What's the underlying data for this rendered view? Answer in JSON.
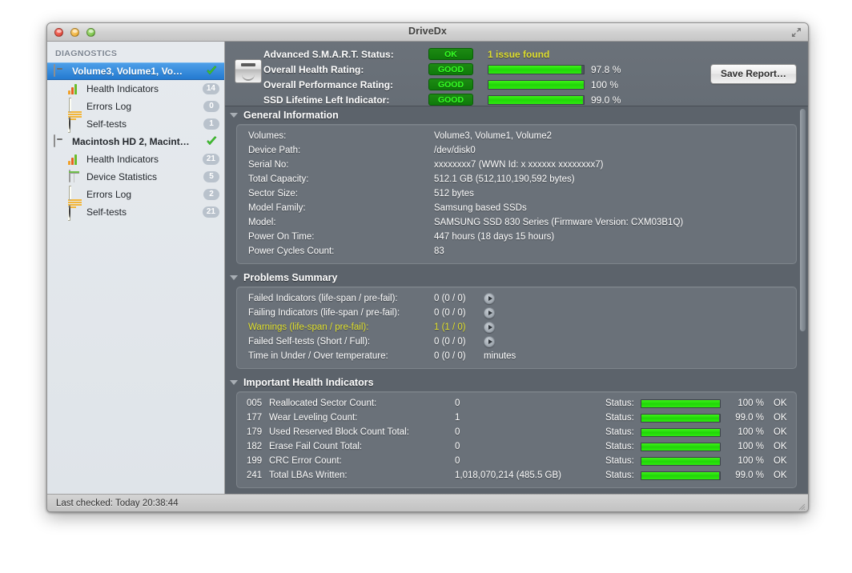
{
  "window": {
    "title": "DriveDx",
    "traffic_lights": [
      "close",
      "minimize",
      "zoom"
    ],
    "fullscreen_icon": "fullscreen-icon"
  },
  "sidebar": {
    "header": "DIAGNOSTICS",
    "items": [
      {
        "label": "Volume3, Volume1, Vo…",
        "icon": "disk-icon",
        "type": "disk",
        "selected": true,
        "status": "ok-check"
      },
      {
        "label": "Health Indicators",
        "icon": "bar-chart-icon",
        "type": "child",
        "badge": "14"
      },
      {
        "label": "Errors Log",
        "icon": "log-icon",
        "type": "child",
        "badge": "0"
      },
      {
        "label": "Self-tests",
        "icon": "pie-icon",
        "type": "child",
        "badge": "1"
      },
      {
        "label": "Macintosh HD 2, Macint…",
        "icon": "disk-icon",
        "type": "disk",
        "selected": false,
        "status": "ok-check"
      },
      {
        "label": "Health Indicators",
        "icon": "bar-chart-icon",
        "type": "child",
        "badge": "21"
      },
      {
        "label": "Device Statistics",
        "icon": "table-icon",
        "type": "child",
        "badge": "5"
      },
      {
        "label": "Errors Log",
        "icon": "log-icon",
        "type": "child",
        "badge": "2"
      },
      {
        "label": "Self-tests",
        "icon": "pie-icon",
        "type": "child",
        "badge": "21"
      }
    ]
  },
  "summary": {
    "disk_icon": "hard-disk-icon",
    "save_report_label": "Save Report…",
    "rows": [
      {
        "label": "Advanced S.M.A.R.T. Status:",
        "badge": "OK",
        "issue": "1 issue found"
      },
      {
        "label": "Overall Health Rating:",
        "badge": "GOOD",
        "percent": "97.8 %",
        "fill": 97.8
      },
      {
        "label": "Overall Performance Rating:",
        "badge": "GOOD",
        "percent": "100 %",
        "fill": 100
      },
      {
        "label": "SSD Lifetime Left Indicator:",
        "badge": "GOOD",
        "percent": "99.0 %",
        "fill": 99.0
      }
    ]
  },
  "general_information": {
    "title": "General Information",
    "rows": [
      {
        "key": "Volumes:",
        "value": "Volume3, Volume1, Volume2"
      },
      {
        "key": "Device Path:",
        "value": "/dev/disk0"
      },
      {
        "key": "Serial No:",
        "value": "xxxxxxxx7 (WWN Id: x xxxxxx xxxxxxxx7)"
      },
      {
        "key": "Total Capacity:",
        "value": "512.1 GB (512,110,190,592 bytes)"
      },
      {
        "key": "Sector Size:",
        "value": "512 bytes"
      },
      {
        "key": "Model Family:",
        "value": "Samsung based SSDs"
      },
      {
        "key": "Model:",
        "value": "SAMSUNG SSD 830 Series  (Firmware Version: CXM03B1Q)"
      },
      {
        "key": "Power On Time:",
        "value": "447 hours (18 days 15 hours)"
      },
      {
        "key": "Power Cycles Count:",
        "value": "83"
      }
    ]
  },
  "problems_summary": {
    "title": "Problems Summary",
    "rows": [
      {
        "key": "Failed Indicators (life-span / pre-fail):",
        "value": "0 (0 / 0)",
        "arrow": true,
        "warn": false
      },
      {
        "key": "Failing Indicators (life-span / pre-fail):",
        "value": "0 (0 / 0)",
        "arrow": true,
        "warn": false
      },
      {
        "key": "Warnings (life-span / pre-fail):",
        "value": "1 (1 / 0)",
        "arrow": true,
        "warn": true
      },
      {
        "key": "Failed Self-tests (Short / Full):",
        "value": "0 (0 / 0)",
        "arrow": true,
        "warn": false
      },
      {
        "key": "Time in Under / Over temperature:",
        "value": "0 (0 / 0)",
        "arrow": false,
        "warn": false,
        "unit": "minutes"
      }
    ]
  },
  "important_health_indicators": {
    "title": "Important Health Indicators",
    "status_label": "Status:",
    "rows": [
      {
        "id": "005",
        "name": "Reallocated Sector Count:",
        "value": "0",
        "percent": "100 %",
        "fill": 100,
        "state": "OK"
      },
      {
        "id": "177",
        "name": "Wear Leveling Count:",
        "value": "1",
        "percent": "99.0 %",
        "fill": 99,
        "state": "OK"
      },
      {
        "id": "179",
        "name": "Used Reserved Block Count Total:",
        "value": "0",
        "percent": "100 %",
        "fill": 100,
        "state": "OK"
      },
      {
        "id": "182",
        "name": "Erase Fail Count Total:",
        "value": "0",
        "percent": "100 %",
        "fill": 100,
        "state": "OK"
      },
      {
        "id": "199",
        "name": "CRC Error Count:",
        "value": "0",
        "percent": "100 %",
        "fill": 100,
        "state": "OK"
      },
      {
        "id": "241",
        "name": "Total LBAs Written:",
        "value": "1,018,070,214 (485.5 GB)",
        "percent": "99.0 %",
        "fill": 99,
        "state": "OK"
      }
    ]
  },
  "statusbar": {
    "text": "Last checked: Today 20:38:44"
  },
  "colors": {
    "accent_selection": "#2b80d4",
    "good_green": "#21d608",
    "badge_green_bg": "#147f0e",
    "warning_yellow": "#dede2e",
    "panel_bg": "#6a7179",
    "content_bg": "#5c636b"
  }
}
